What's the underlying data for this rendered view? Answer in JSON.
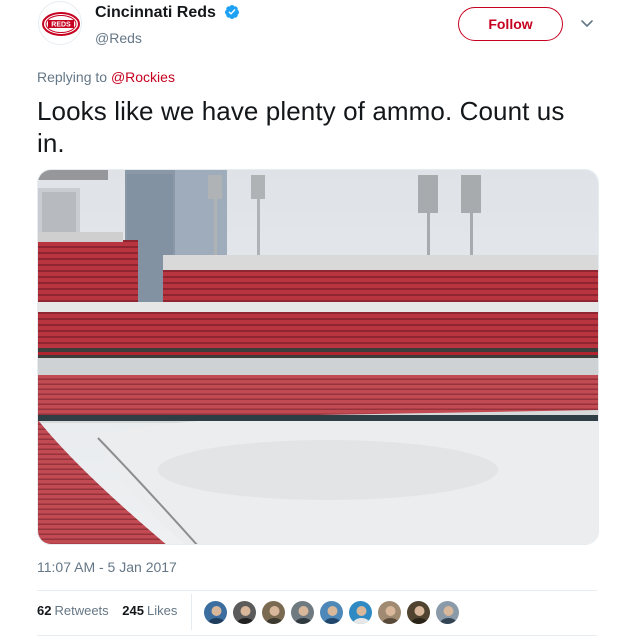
{
  "header": {
    "display_name": "Cincinnati Reds",
    "handle": "@Reds",
    "follow_label": "Follow",
    "logo_text": "REDS",
    "verified_icon": "verified-badge-icon",
    "menu_icon": "chevron-down-icon"
  },
  "reply": {
    "prefix": "Replying to",
    "to_handle": "@Rockies"
  },
  "tweet": {
    "text": "Looks like we have plenty of ammo. Count us in.",
    "media_description_icon": "stadium-photo"
  },
  "meta": {
    "timestamp": "11:07 AM - 5 Jan 2017"
  },
  "stats": {
    "retweets_count": "62",
    "retweets_label": "Retweets",
    "likes_count": "245",
    "likes_label": "Likes"
  },
  "likers": [
    {
      "color": "#3b6e9e",
      "shirt": "#1f3d5c"
    },
    {
      "color": "#5b5b5b",
      "shirt": "#222222"
    },
    {
      "color": "#7a6a52",
      "shirt": "#3d3a30"
    },
    {
      "color": "#6f7a80",
      "shirt": "#2e3940"
    },
    {
      "color": "#4d88b8",
      "shirt": "#20466b"
    },
    {
      "color": "#2f8ac4",
      "shirt": "#e8e8e8"
    },
    {
      "color": "#a08a72",
      "shirt": "#5a4a3a"
    },
    {
      "color": "#50432f",
      "shirt": "#2a2418"
    },
    {
      "color": "#8a9aa8",
      "shirt": "#334455"
    }
  ],
  "colors": {
    "brand_red": "#c6011f",
    "text_primary": "#14171a",
    "text_secondary": "#657786",
    "verified_blue": "#1da1f2",
    "border": "#e6ecf0"
  }
}
